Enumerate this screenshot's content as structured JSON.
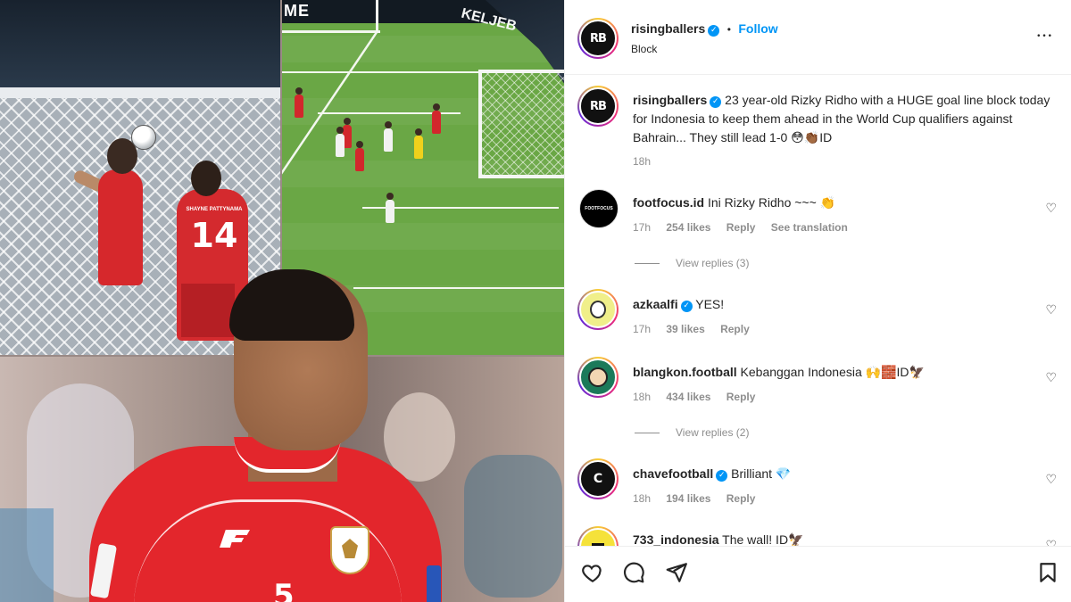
{
  "image_text": {
    "ad_board_left": "ME",
    "ad_board_right": "KELJEB",
    "shirt_name": "SHAYNE PATTYNAMA",
    "shirt_number": "14",
    "jersey_number": "5"
  },
  "header": {
    "username": "risingballers",
    "follow_label": "Follow",
    "separator": "•",
    "subtitle": "Block",
    "more_label": "•••",
    "avatar_text": "RB"
  },
  "caption": {
    "username": "risingballers",
    "text": "23 year-old Rizky Ridho with a HUGE goal line block today for Indonesia to keep them ahead in the World Cup qualifiers against Bahrain... They still lead 1-0 😳👏🏾ID",
    "time": "18h"
  },
  "comments": [
    {
      "username": "footfocus.id",
      "text": "Ini Rizky Ridho ~~~ 👏",
      "time": "17h",
      "likes": "254 likes",
      "reply": "Reply",
      "translate": "See translation",
      "view_replies": "View replies (3)",
      "verified": false
    },
    {
      "username": "azkaalfi",
      "text": "YES!",
      "time": "17h",
      "likes": "39 likes",
      "reply": "Reply",
      "translate": "",
      "view_replies": "",
      "verified": true
    },
    {
      "username": "blangkon.football",
      "text": "Kebanggan Indonesia 🙌🧱ID🦅",
      "time": "18h",
      "likes": "434 likes",
      "reply": "Reply",
      "translate": "",
      "view_replies": "View replies (2)",
      "verified": false
    },
    {
      "username": "chavefootball",
      "text": "Brilliant 💎",
      "time": "18h",
      "likes": "194 likes",
      "reply": "Reply",
      "translate": "",
      "view_replies": "",
      "verified": true
    },
    {
      "username": "733_indonesia",
      "text": "The wall! ID🦅",
      "time": "",
      "likes": "",
      "reply": "",
      "translate": "",
      "view_replies": "",
      "verified": false
    }
  ],
  "icons": {
    "like": "heart-icon",
    "comment": "comment-icon",
    "share": "share-icon",
    "save": "bookmark-icon"
  },
  "colors": {
    "link_blue": "#0095f6",
    "muted": "#8e8e8e",
    "text": "#262626"
  }
}
